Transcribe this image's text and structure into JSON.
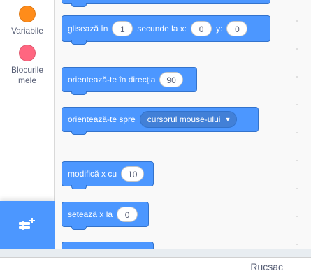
{
  "categories": [
    {
      "label": "Variabile",
      "color": "#ff8c1a"
    },
    {
      "label": "Blocurile mele",
      "color": "#ff6680"
    }
  ],
  "extension_button": {
    "icon": "add-extension-icon",
    "color": "#4c97ff"
  },
  "blocks": {
    "glide": {
      "text1": "glisează în",
      "secs": "1",
      "text2": "secunde la x:",
      "x": "0",
      "text3": "y:",
      "y": "0"
    },
    "point_direction": {
      "text": "orientează-te în direcția",
      "value": "90"
    },
    "point_towards": {
      "text": "orientează-te spre",
      "option": "cursorul mouse-ului"
    },
    "change_x": {
      "text": "modifică x cu",
      "value": "10"
    },
    "set_x": {
      "text": "setează x la",
      "value": "0"
    }
  },
  "sprite_bar": {
    "sprite_name": "Rucsac"
  },
  "colors": {
    "motion": "#4c97ff",
    "motion_border": "#3373cc"
  }
}
